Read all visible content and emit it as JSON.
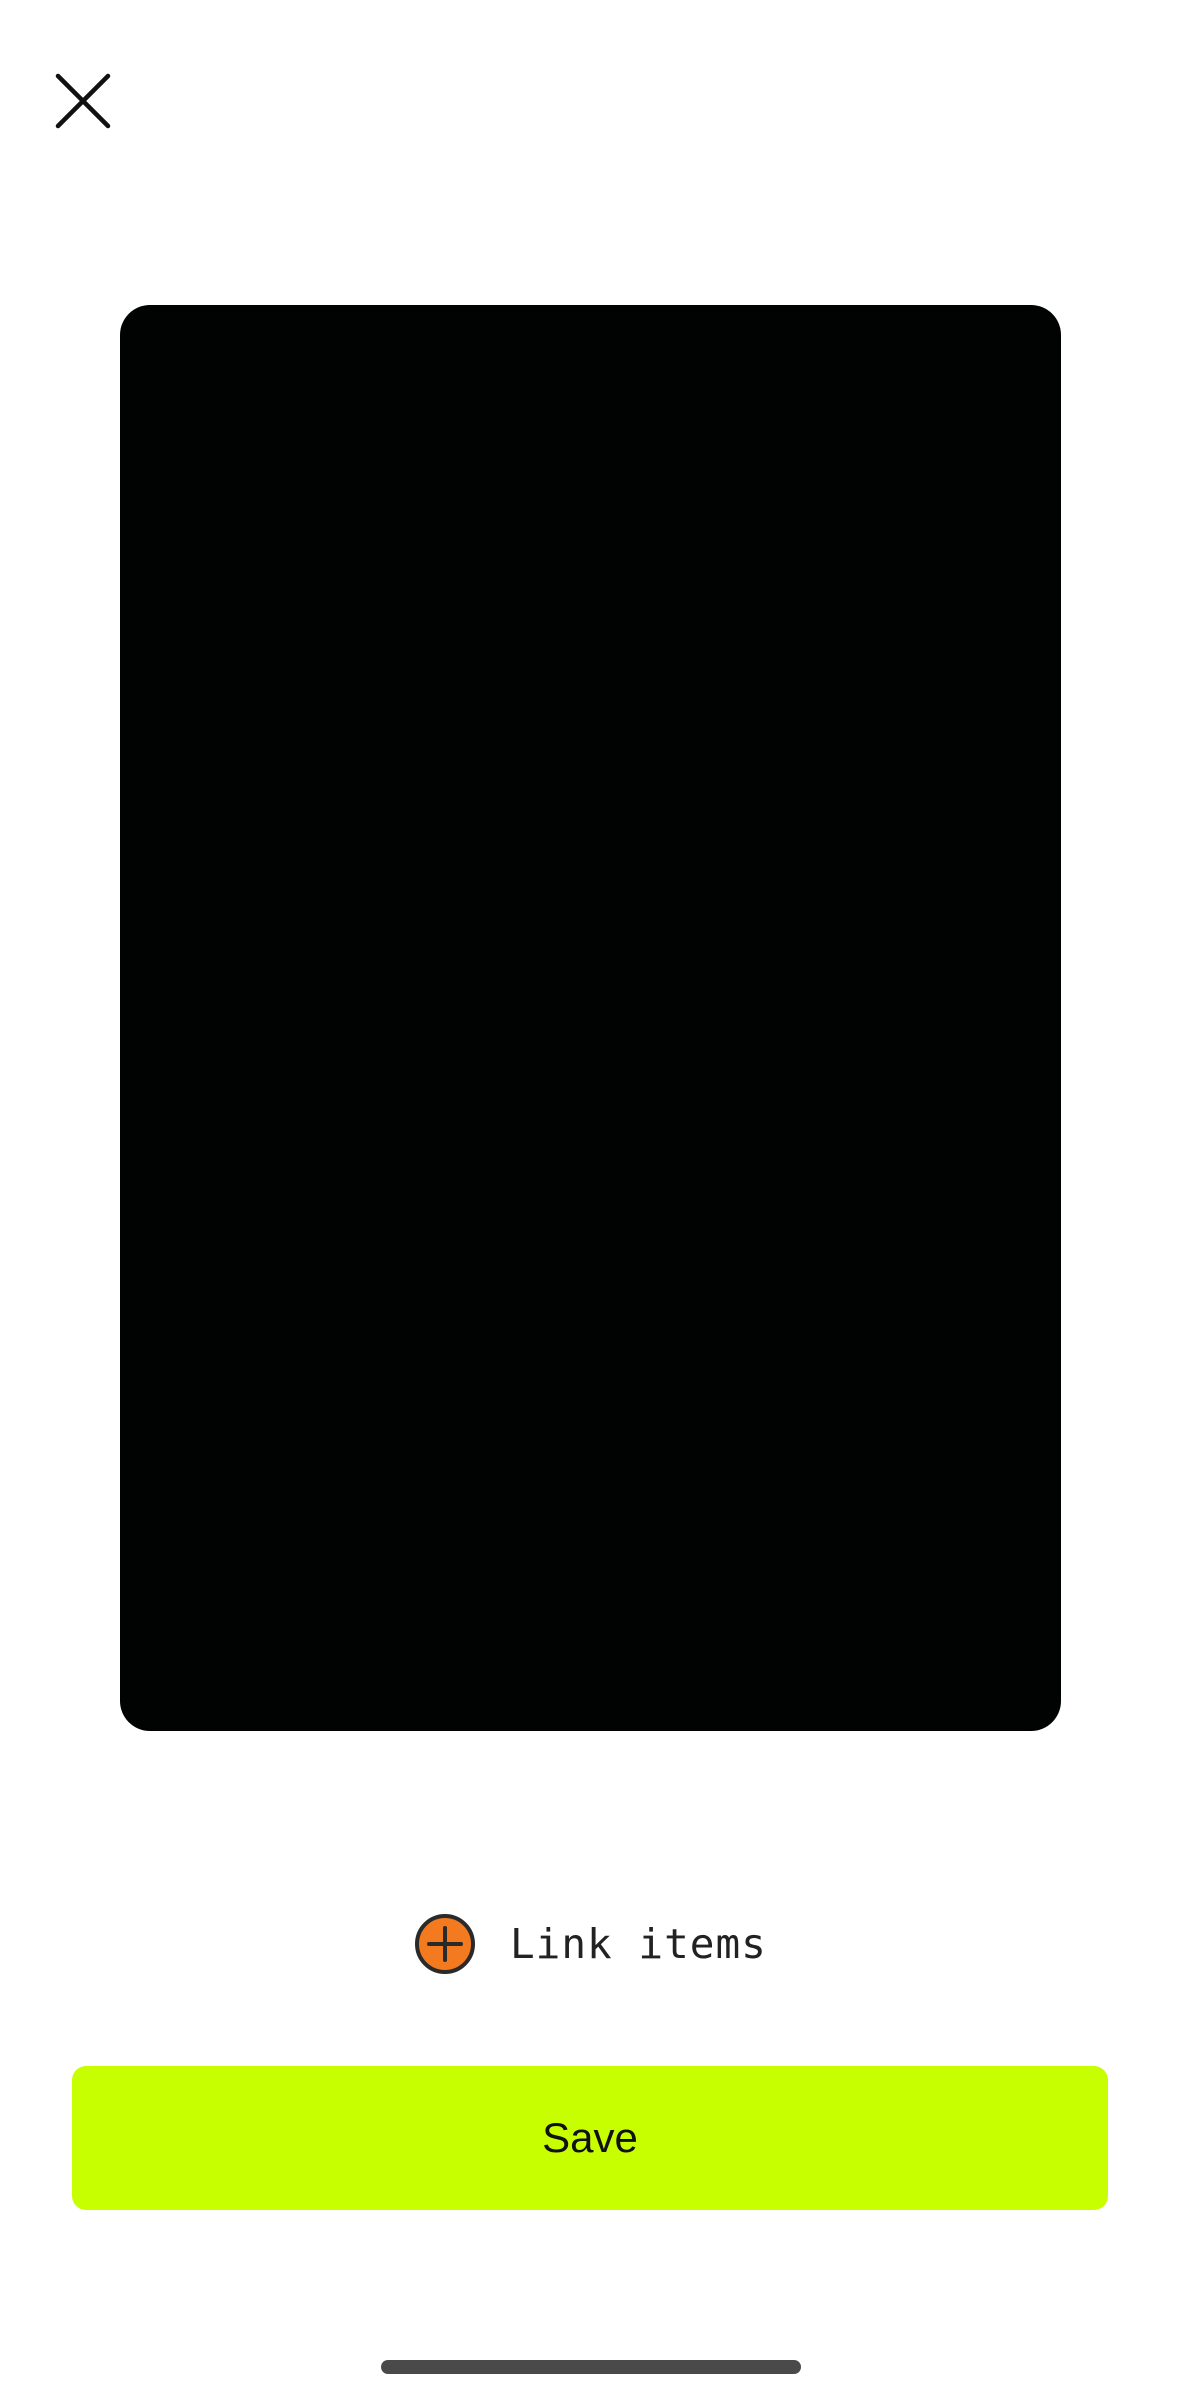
{
  "header": {
    "close_icon": "close-icon"
  },
  "preview": {
    "background": "#010303"
  },
  "link_items": {
    "label": "Link items",
    "icon": "plus-circle-icon",
    "icon_color": "#f47a20"
  },
  "save_button": {
    "label": "Save",
    "color": "#c8ff00"
  }
}
